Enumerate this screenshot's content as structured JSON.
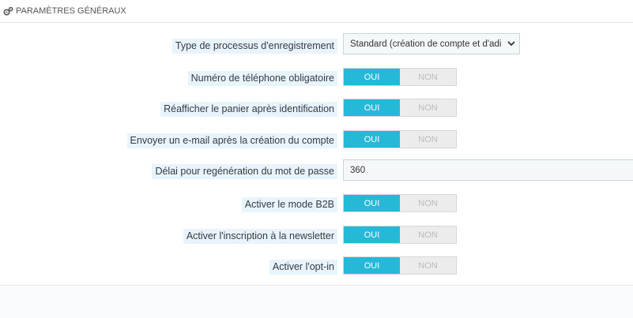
{
  "panel": {
    "icon": "cogs-icon",
    "title": "PARAMÈTRES GÉNÉRAUX"
  },
  "fields": {
    "registration_process": {
      "label": "Type de processus d'enregistrement",
      "value": "Standard (création de compte et d'adi"
    },
    "phone_required": {
      "label": "Numéro de téléphone obligatoire",
      "on_label": "OUI",
      "off_label": "NON",
      "value": "OUI"
    },
    "cart_after_login": {
      "label": "Réafficher le panier après identification",
      "on_label": "OUI",
      "off_label": "NON",
      "value": "OUI"
    },
    "send_email": {
      "label": "Envoyer un e-mail après la création du compte",
      "on_label": "OUI",
      "off_label": "NON",
      "value": "OUI"
    },
    "password_regen": {
      "label": "Délai pour regénération du mot de passe",
      "value": "360"
    },
    "b2b_mode": {
      "label": "Activer le mode B2B",
      "on_label": "OUI",
      "off_label": "NON",
      "value": "OUI"
    },
    "newsletter": {
      "label": "Activer l'inscription à la newsletter",
      "on_label": "OUI",
      "off_label": "NON",
      "value": "OUI"
    },
    "optin": {
      "label": "Activer l'opt-in",
      "on_label": "OUI",
      "off_label": "NON",
      "value": "OUI"
    }
  },
  "colors": {
    "switch_on": "#25b9d7",
    "label_highlight": "#e8f4fb"
  }
}
